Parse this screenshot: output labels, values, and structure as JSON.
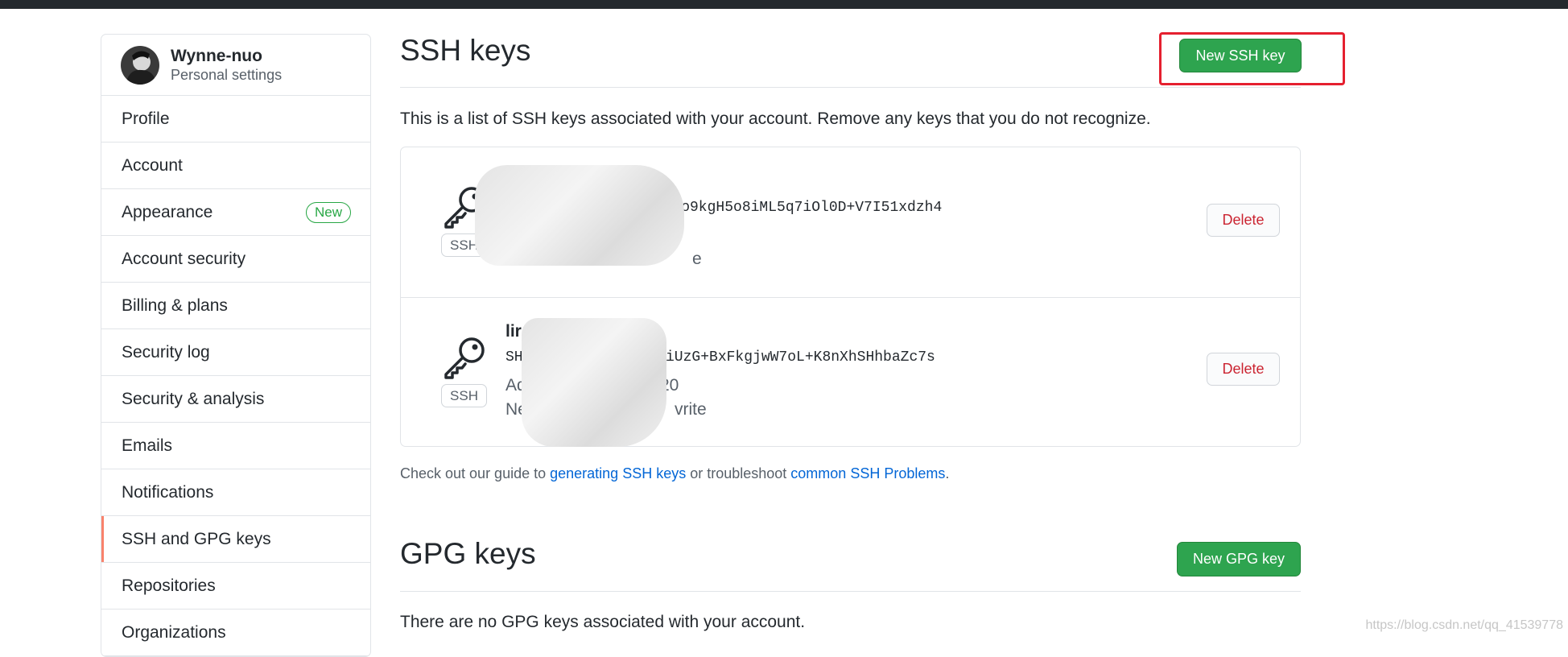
{
  "user": {
    "name": "Wynne-nuo",
    "subtitle": "Personal settings"
  },
  "sidebar": {
    "items": [
      {
        "label": "Profile"
      },
      {
        "label": "Account"
      },
      {
        "label": "Appearance",
        "badge": "New"
      },
      {
        "label": "Account security"
      },
      {
        "label": "Billing & plans"
      },
      {
        "label": "Security log"
      },
      {
        "label": "Security & analysis"
      },
      {
        "label": "Emails"
      },
      {
        "label": "Notifications"
      },
      {
        "label": "SSH and GPG keys",
        "selected": true
      },
      {
        "label": "Repositories"
      },
      {
        "label": "Organizations"
      }
    ]
  },
  "ssh": {
    "title": "SSH keys",
    "new_button": "New SSH key",
    "description": "This is a list of SSH keys associated with your account. Remove any keys that you do not recognize.",
    "keys": [
      {
        "type_label": "SSH",
        "title": "",
        "fingerprint": "/TyJo9kgH5o8iML5q7iOl0D+V7I51xdzh4",
        "added": "A",
        "last_used": "Never us",
        "last_used_tail": "e",
        "delete_label": "Delete"
      },
      {
        "type_label": "SSH",
        "title": "lir",
        "fingerprint_prefix": "SHA",
        "fingerprint": "kjdkIiUzG+BxFkgjwW7oL+K8nXhSHhbaZc7s",
        "added": "Adde",
        "added_tail": "20",
        "last_used": "Never us",
        "last_used_tail": "vrite",
        "delete_label": "Delete"
      }
    ],
    "guide_prefix": "Check out our guide to ",
    "guide_link1": "generating SSH keys",
    "guide_mid": " or troubleshoot ",
    "guide_link2": "common SSH Problems",
    "guide_suffix": "."
  },
  "gpg": {
    "title": "GPG keys",
    "new_button": "New GPG key",
    "description": "There are no GPG keys associated with your account."
  },
  "watermark": "https://blog.csdn.net/qq_41539778",
  "colors": {
    "accent_green": "#2ea44f",
    "danger": "#cb2431",
    "link": "#0366d6",
    "selected_bar": "#f9826c",
    "highlight": "#e5202f"
  }
}
